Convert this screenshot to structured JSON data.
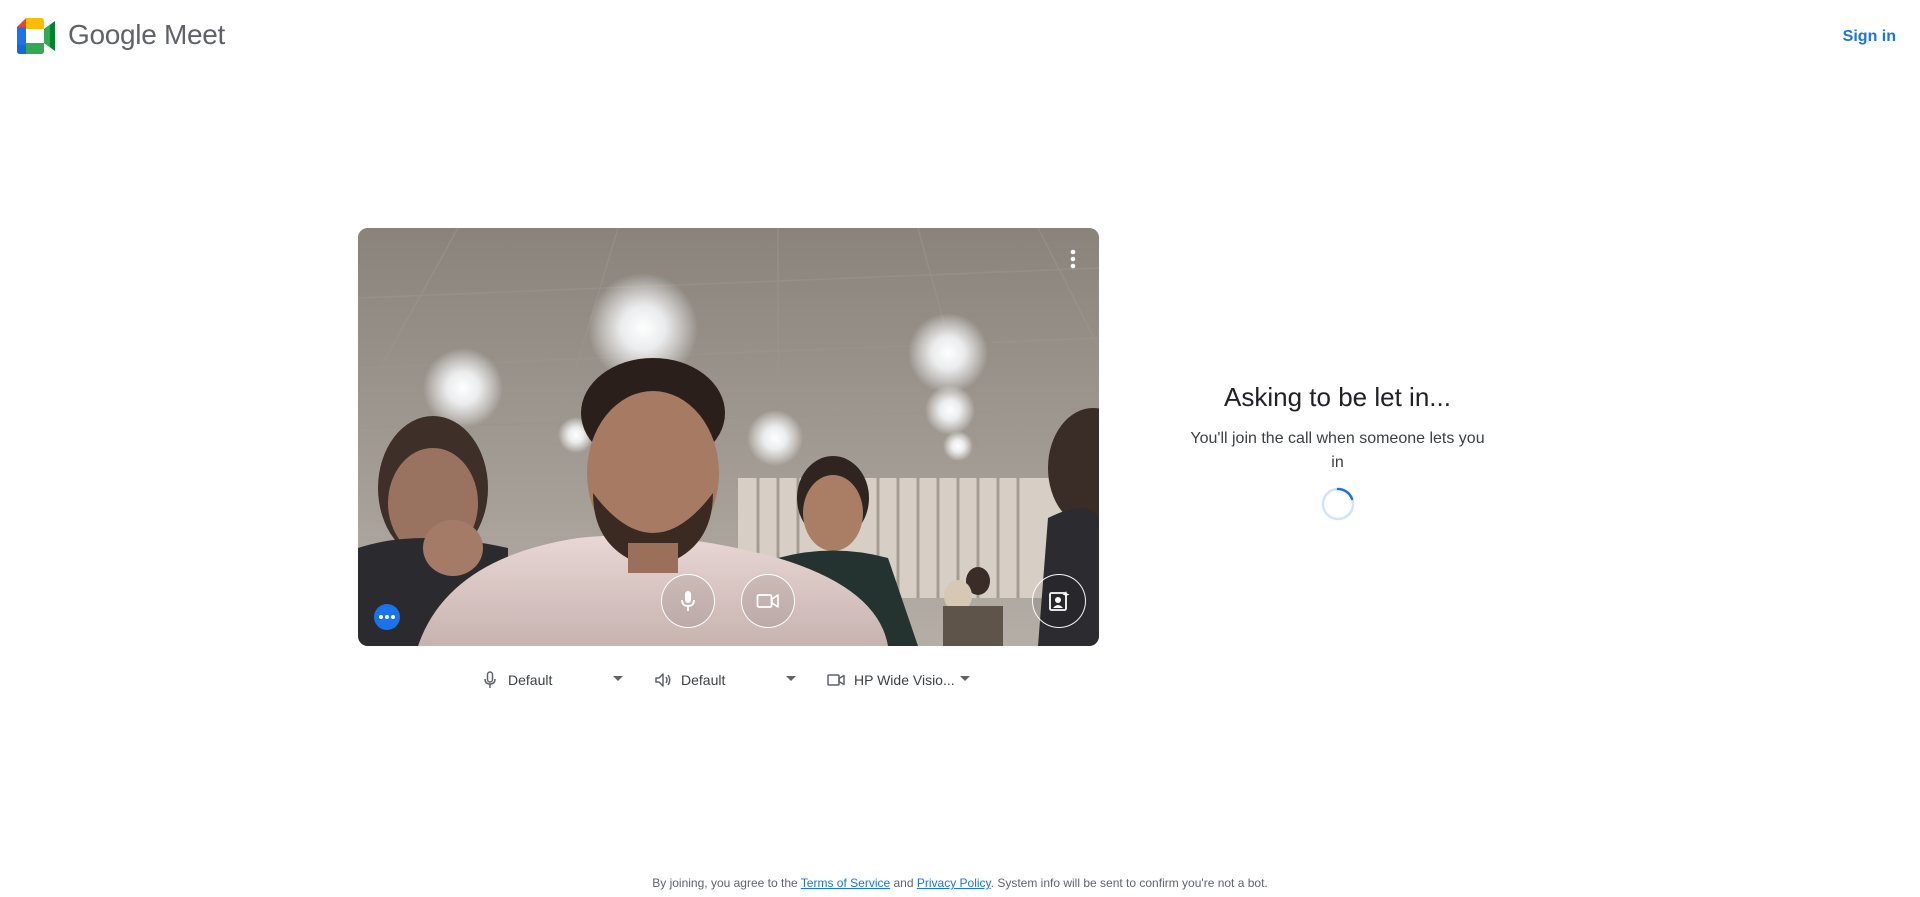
{
  "header": {
    "brand": "Google Meet",
    "sign_in": "Sign in"
  },
  "preview": {
    "more_options_icon": "more-vert-icon",
    "mic_icon": "microphone-icon",
    "camera_icon": "videocam-icon",
    "effects_icon": "visual-effects-icon",
    "dots_icon": "more-horiz-icon"
  },
  "devices": {
    "microphone": "Default",
    "speaker": "Default",
    "camera": "HP Wide Visio..."
  },
  "status": {
    "title": "Asking to be let in...",
    "subtitle": "You'll join the call when someone lets you in"
  },
  "footer": {
    "prefix": "By joining, you agree to the ",
    "terms": "Terms of Service",
    "and": " and ",
    "privacy": "Privacy Policy",
    "suffix": ". System info will be sent to confirm you're not a bot."
  },
  "colors": {
    "accent": "#1a73e8",
    "text": "#202124",
    "muted": "#5f6368"
  }
}
